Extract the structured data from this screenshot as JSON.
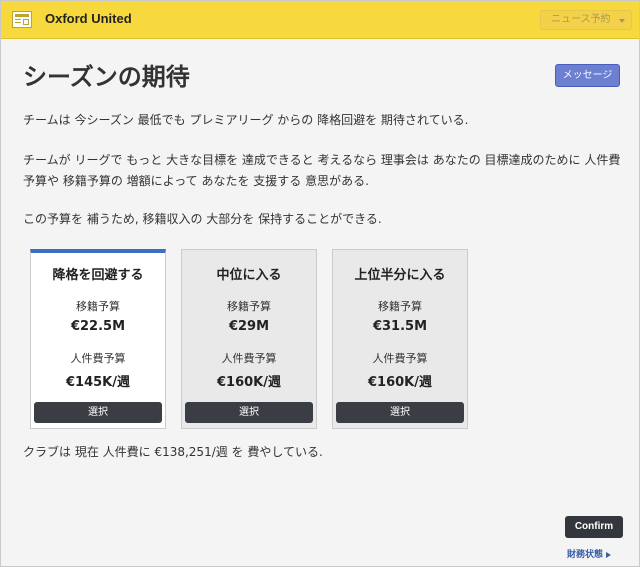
{
  "header": {
    "club_name": "Oxford United",
    "news_button": "ニュース予約",
    "club_icon": "newspaper-icon"
  },
  "page": {
    "title": "シーズンの期待",
    "message_button": "メッセージ"
  },
  "body": {
    "paragraph1": "チームは 今シーズン 最低でも プレミアリーグ からの 降格回避を 期待されている.",
    "paragraph2": "チームが リーグで もっと 大きな目標を 達成できると 考えるなら 理事会は あなたの 目標達成のために 人件費予算や 移籍予算の 増額によって あなたを 支援する 意思がある.",
    "paragraph3": "この予算を 補うため, 移籍収入の 大部分を 保持することができる."
  },
  "options": [
    {
      "title": "降格を回避する",
      "transfer_label": "移籍予算",
      "transfer_value": "€22.5M",
      "wage_label": "人件費予算",
      "wage_value": "€145K/週",
      "button": "選択",
      "selected": true
    },
    {
      "title": "中位に入る",
      "transfer_label": "移籍予算",
      "transfer_value": "€29M",
      "wage_label": "人件費予算",
      "wage_value": "€160K/週",
      "button": "選択",
      "selected": false
    },
    {
      "title": "上位半分に入る",
      "transfer_label": "移籍予算",
      "transfer_value": "€31.5M",
      "wage_label": "人件費予算",
      "wage_value": "€160K/週",
      "button": "選択",
      "selected": false
    }
  ],
  "footer": {
    "note": "クラブは 現在 人件費に €138,251/週 を 費やしている.",
    "confirm": "Confirm",
    "finance_link": "財務状態"
  },
  "colors": {
    "header_bg": "#f7d93e",
    "accent_blue": "#3a6fc4",
    "message_button": "#6c7fd0",
    "dark_button": "#3a3d44"
  }
}
